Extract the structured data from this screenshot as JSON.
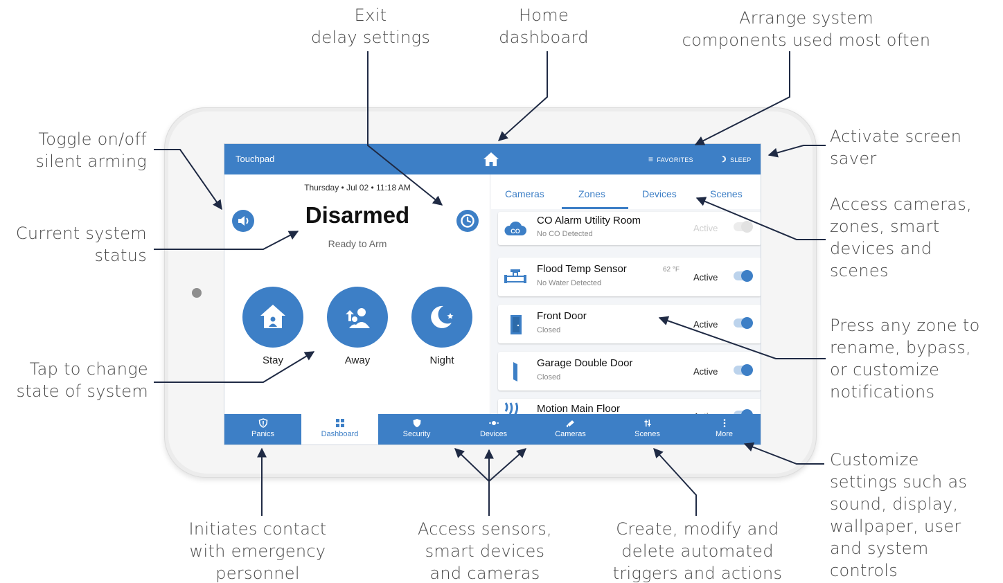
{
  "callouts": {
    "exit_delay": [
      "Exit",
      "delay settings"
    ],
    "home_dashboard": [
      "Home",
      "dashboard"
    ],
    "arrange": [
      "Arrange system",
      "components used most often"
    ],
    "toggle_silent": [
      "Toggle on/off",
      "silent arming"
    ],
    "screen_saver": [
      "Activate screen",
      "saver"
    ],
    "current_status": [
      "Current system",
      "status"
    ],
    "access_cameras": [
      "Access cameras,",
      "zones, smart",
      "devices and",
      "scenes"
    ],
    "tap_change": [
      "Tap to change",
      "state of system"
    ],
    "press_zone": [
      "Press any zone to",
      "rename, bypass,",
      "or customize",
      "notifications"
    ],
    "customize": [
      "Customize",
      "settings such as",
      "sound, display,",
      "wallpaper, user",
      "and system",
      "controls"
    ],
    "initiates": [
      "Initiates contact",
      "with emergency",
      "personnel"
    ],
    "access_sensors": [
      "Access sensors,",
      "smart devices",
      "and cameras"
    ],
    "create_modify": [
      "Create, modify and",
      "delete automated",
      "triggers and actions"
    ]
  },
  "topbar": {
    "title": "Touchpad",
    "favorites": "FAVORITES",
    "sleep": "SLEEP",
    "home_icon": "home-icon"
  },
  "status_panel": {
    "datetime": "Thursday  •  Jul 02  •  11:18 AM",
    "status": "Disarmed",
    "substatus": "Ready to Arm"
  },
  "arm_buttons": [
    {
      "label": "Stay",
      "icon": "house-person-icon"
    },
    {
      "label": "Away",
      "icon": "people-arrow-icon"
    },
    {
      "label": "Night",
      "icon": "moon-stars-icon"
    }
  ],
  "tabs": [
    "Cameras",
    "Zones",
    "Devices",
    "Scenes"
  ],
  "active_tab": "Zones",
  "zones": [
    {
      "name": "CO Alarm Utility Room",
      "sub": "No CO Detected",
      "temp": "",
      "state": "Active",
      "icon": "co-cloud-icon"
    },
    {
      "name": "Flood Temp Sensor",
      "sub": "No Water Detected",
      "temp": "62 °F",
      "state": "Active",
      "icon": "pipe-icon"
    },
    {
      "name": "Front Door",
      "sub": "Closed",
      "temp": "",
      "state": "Active",
      "icon": "door-icon"
    },
    {
      "name": "Garage Double Door",
      "sub": "Closed",
      "temp": "",
      "state": "Active",
      "icon": "door-panel-icon"
    },
    {
      "name": "Motion Main Floor",
      "sub": "",
      "temp": "",
      "state": "Active",
      "icon": "motion-icon"
    }
  ],
  "bottom_nav": [
    {
      "label": "Panics",
      "icon": "shield-alert-icon"
    },
    {
      "label": "Dashboard",
      "icon": "grid-icon"
    },
    {
      "label": "Security",
      "icon": "shield-icon"
    },
    {
      "label": "Devices",
      "icon": "bulb-icon"
    },
    {
      "label": "Cameras",
      "icon": "camera-icon"
    },
    {
      "label": "Scenes",
      "icon": "sliders-icon"
    },
    {
      "label": "More",
      "icon": "dots-icon"
    }
  ],
  "active_nav": "Dashboard",
  "colors": {
    "accent": "#3d7fc6",
    "callout_text": "#4a4a4a",
    "leader_line": "#1f2a44"
  }
}
